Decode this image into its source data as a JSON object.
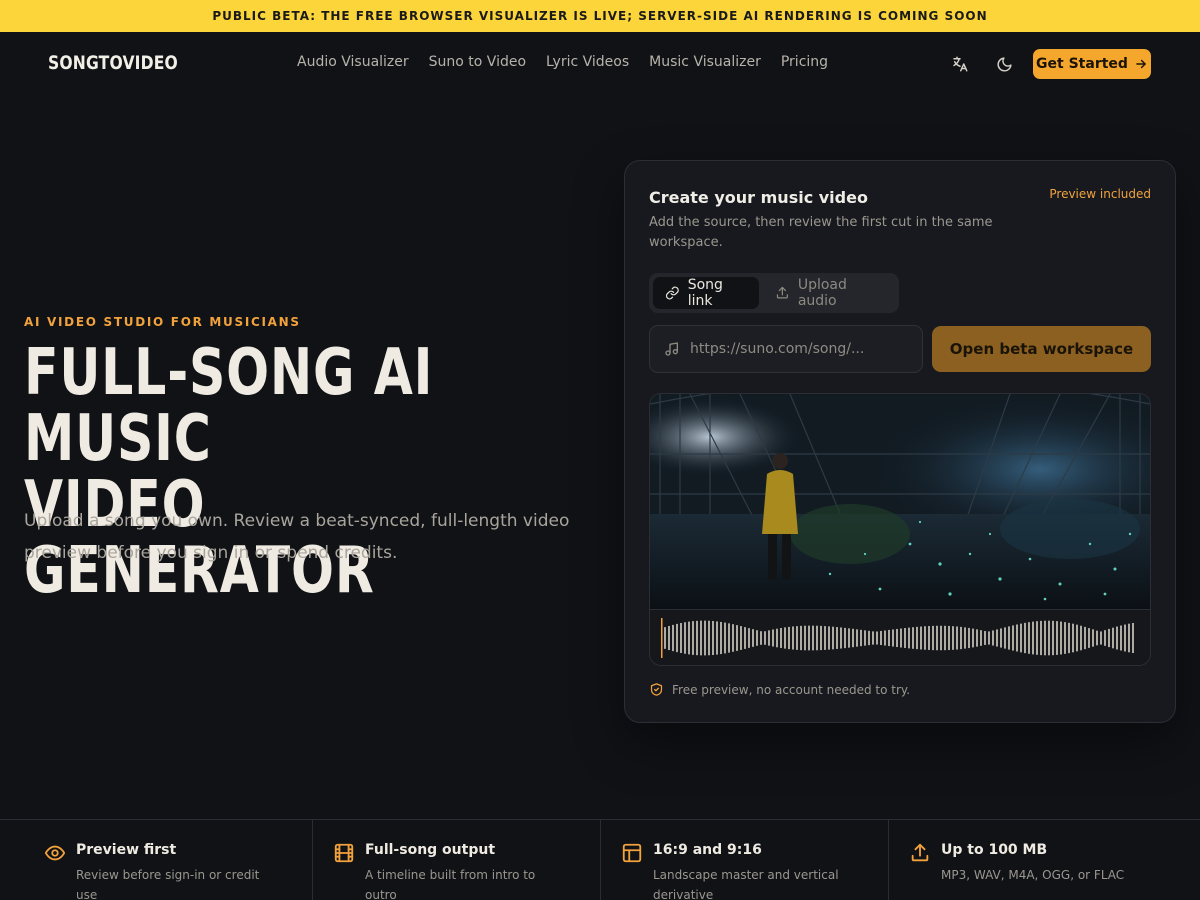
{
  "banner": {
    "text": "PUBLIC BETA: THE FREE BROWSER VISUALIZER IS LIVE; SERVER-SIDE AI RENDERING IS COMING SOON"
  },
  "nav": {
    "logo": "SONGTOVIDEO",
    "links": [
      "Audio Visualizer",
      "Suno to Video",
      "Lyric Videos",
      "Music Visualizer",
      "Pricing"
    ],
    "icons": [
      "translate-icon",
      "moon-icon"
    ],
    "cta": "Get Started"
  },
  "hero": {
    "eyebrow": "AI VIDEO STUDIO FOR MUSICIANS",
    "headline_line1": "FULL-SONG AI MUSIC",
    "headline_line2": "VIDEO GENERATOR",
    "subhead": "Upload a song you own. Review a beat-synced, full-length video preview before you sign in or spend credits."
  },
  "card": {
    "title": "Create your music video",
    "description": "Add the source, then review the first cut in the same workspace.",
    "badge": "Preview included",
    "tabs": [
      {
        "label": "Song link",
        "icon": "link-icon",
        "active": true
      },
      {
        "label": "Upload audio",
        "icon": "upload-icon",
        "active": false
      }
    ],
    "input_placeholder": "https://suno.com/song/...",
    "input_value": "",
    "submit_label": "Open beta workspace",
    "footnote": "Free preview, no account needed to try."
  },
  "features": [
    {
      "icon": "eye-icon",
      "title": "Preview first",
      "subtitle": "Review before sign-in or credit use"
    },
    {
      "icon": "film-icon",
      "title": "Full-song output",
      "subtitle": "A timeline built from intro to outro"
    },
    {
      "icon": "layout-icon",
      "title": "16:9 and 9:16",
      "subtitle": "Landscape master and vertical derivative"
    },
    {
      "icon": "upload-icon",
      "title": "Up to 100 MB",
      "subtitle": "MP3, WAV, M4A, OGG, or FLAC"
    }
  ],
  "colors": {
    "accent": "#f5a62c",
    "banner": "#fcd53a",
    "background": "#101216",
    "card": "#17191e"
  }
}
